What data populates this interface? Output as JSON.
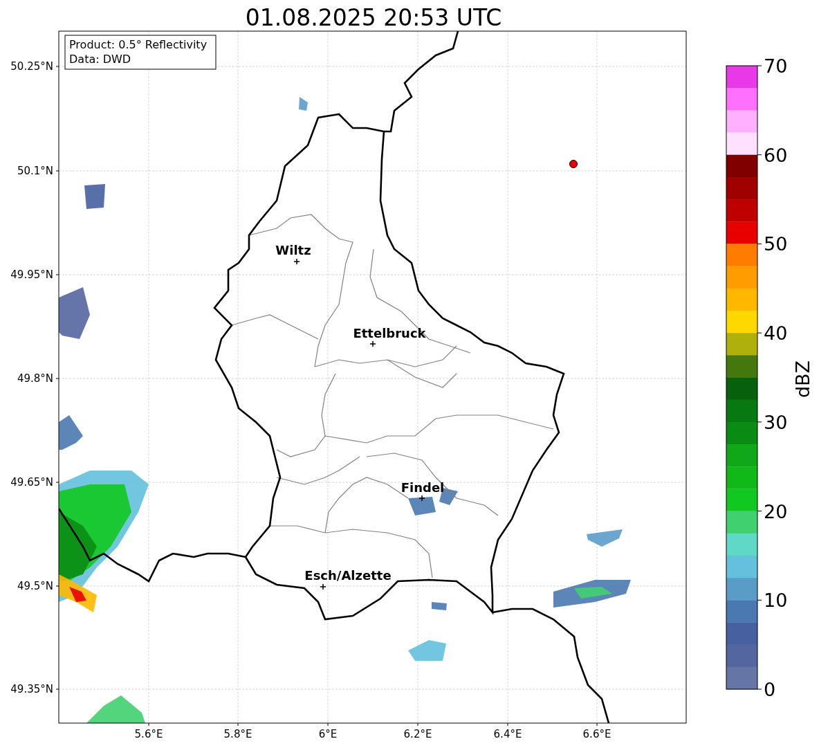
{
  "title": "01.08.2025 20:53 UTC",
  "info_box": [
    "Product: 0.5° Reflectivity",
    "Data: DWD"
  ],
  "lat_ticks": [
    "50.25°N",
    "50.1°N",
    "49.95°N",
    "49.8°N",
    "49.65°N",
    "49.5°N",
    "49.35°N"
  ],
  "lon_ticks": [
    "5.6°E",
    "5.8°E",
    "6°E",
    "6.2°E",
    "6.4°E",
    "6.6°E"
  ],
  "cities": [
    {
      "name": "Wiltz"
    },
    {
      "name": "Ettelbruck"
    },
    {
      "name": "Findel"
    },
    {
      "name": "Esch/Alzette"
    }
  ],
  "colorbar": {
    "label": "dBZ",
    "ticks": [
      "70",
      "60",
      "50",
      "40",
      "30",
      "20",
      "10",
      "0"
    ],
    "segments": [
      {
        "color": "#e838e8"
      },
      {
        "color": "#ff70ff"
      },
      {
        "color": "#ffb0ff"
      },
      {
        "color": "#ffe0ff"
      },
      {
        "color": "#800000"
      },
      {
        "color": "#a00000"
      },
      {
        "color": "#c00000"
      },
      {
        "color": "#e80000"
      },
      {
        "color": "#ff7c00"
      },
      {
        "color": "#ff9c00"
      },
      {
        "color": "#ffb800"
      },
      {
        "color": "#ffd800"
      },
      {
        "color": "#b0b00c"
      },
      {
        "color": "#44780c"
      },
      {
        "color": "#06600c"
      },
      {
        "color": "#087810"
      },
      {
        "color": "#0a8c14"
      },
      {
        "color": "#10a818"
      },
      {
        "color": "#10b818"
      },
      {
        "color": "#10c820"
      },
      {
        "color": "#40d070"
      },
      {
        "color": "#60d8c8"
      },
      {
        "color": "#64c0dc"
      },
      {
        "color": "#5a9cc8"
      },
      {
        "color": "#4a78b0"
      },
      {
        "color": "#4660a0"
      },
      {
        "color": "#5466a0"
      },
      {
        "color": "#6475a6"
      }
    ]
  }
}
